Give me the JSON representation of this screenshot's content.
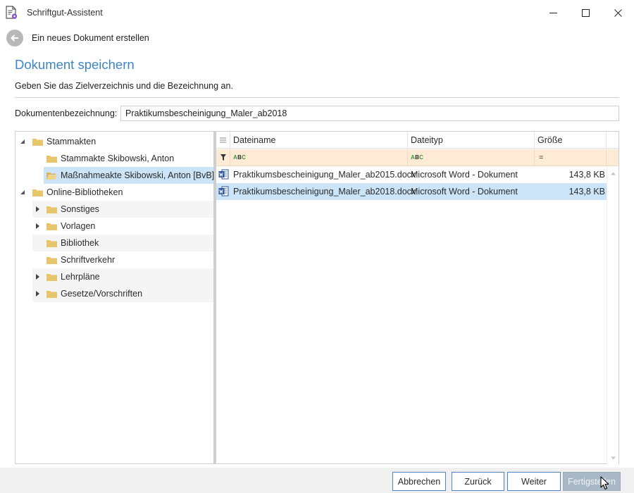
{
  "window": {
    "title": "Schriftgut-Assistent",
    "icon": "document-gear-icon",
    "controls": [
      "minimize-icon",
      "maximize-icon",
      "close-icon"
    ]
  },
  "nav": {
    "back_icon": "arrow-left-icon",
    "title": "Ein neues Dokument erstellen"
  },
  "page": {
    "title": "Dokument speichern",
    "subtitle": "Geben Sie das Zielverzeichnis und die Bezeichnung an."
  },
  "docname": {
    "label": "Dokumentenbezeichnung:",
    "value": "Praktikumsbescheinigung_Maler_ab2018"
  },
  "tree": {
    "items": [
      {
        "label": "Stammakten",
        "expanded": true
      },
      {
        "label": "Stammakte Skibowski, Anton"
      },
      {
        "label": "Maßnahmeakte Skibowski, Anton [BvB]",
        "selected": true
      },
      {
        "label": "Online-Bibliotheken",
        "expanded": true
      },
      {
        "label": "Sonstiges"
      },
      {
        "label": "Vorlagen"
      },
      {
        "label": "Bibliothek"
      },
      {
        "label": "Schriftverkehr"
      },
      {
        "label": "Lehrpläne"
      },
      {
        "label": "Gesetze/Vorschriften"
      }
    ]
  },
  "grid": {
    "columns": [
      "Dateiname",
      "Dateityp",
      "Größe"
    ],
    "filter": {
      "text_icon": "abc-filter-icon",
      "size_operator": "="
    },
    "rows": [
      {
        "name": "Praktikumsbescheinigung_Maler_ab2015.docx",
        "type": "Microsoft Word - Dokument",
        "size": "143,8 KB"
      },
      {
        "name": "Praktikumsbescheinigung_Maler_ab2018.docx",
        "type": "Microsoft Word - Dokument",
        "size": "143,8 KB",
        "selected": true
      }
    ]
  },
  "footer": {
    "cancel": "Abbrechen",
    "back": "Zurück",
    "next": "Weiter",
    "finish": "Fertigstellen"
  },
  "colors": {
    "accent": "#3d85c6",
    "selection": "#cce4f7",
    "filter_bg": "#fdebd6",
    "folder": "#e8c46a",
    "word_blue": "#2b579a"
  }
}
